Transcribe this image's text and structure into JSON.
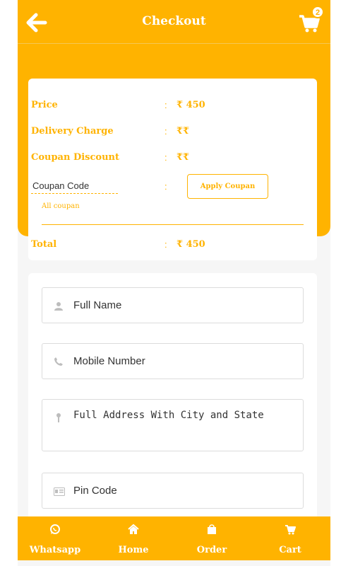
{
  "header": {
    "title": "Checkout",
    "back_icon": "arrow-left-icon",
    "cart_icon": "cart-icon",
    "cart_count": "2"
  },
  "summary": {
    "price_label": "Price",
    "price_value": "₹ 450",
    "delivery_label": "Delivery Charge",
    "delivery_value": "₹₹",
    "discount_label": "Coupan Discount",
    "discount_value": "₹₹",
    "coupon_placeholder": "Coupan Code",
    "apply_label": "Apply Coupan",
    "all_coupon_label": "All coupan",
    "total_label": "Total",
    "total_value": "₹ 450",
    "colon": ":"
  },
  "form": {
    "full_name_placeholder": "Full Name",
    "mobile_placeholder": "Mobile Number",
    "address_placeholder": "Full Address With City and State",
    "pin_placeholder": "Pin Code"
  },
  "nav": [
    {
      "label": "Whatsapp",
      "icon": "whatsapp-icon"
    },
    {
      "label": "Home",
      "icon": "home-icon"
    },
    {
      "label": "Order",
      "icon": "shopping-bag-icon"
    },
    {
      "label": "Cart",
      "icon": "cart-icon"
    }
  ],
  "colors": {
    "accent": "#ffb300",
    "background": "#f6f6f6",
    "card": "#ffffff"
  }
}
